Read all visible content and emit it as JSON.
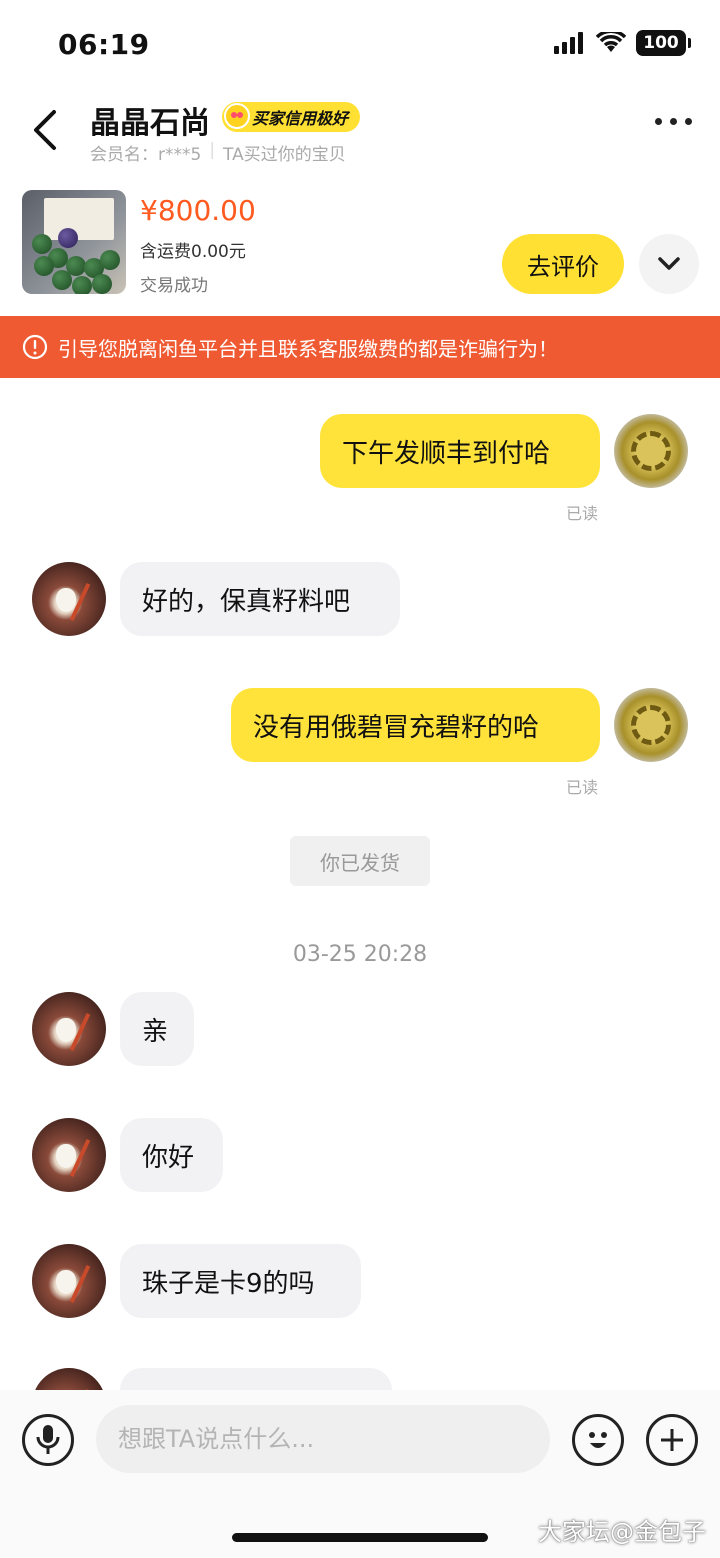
{
  "status_bar": {
    "time": "06:19",
    "battery": "100"
  },
  "header": {
    "title": "晶晶石尚",
    "credit_badge": "买家信用极好",
    "member_name": "会员名：r***5",
    "bought_note": "TA买过你的宝贝"
  },
  "product": {
    "price": "¥800.00",
    "shipping": "含运费0.00元",
    "status": "交易成功",
    "review_label": "去评价"
  },
  "warning": {
    "text": "引导您脱离闲鱼平台并且联系客服缴费的都是诈骗行为！"
  },
  "messages": {
    "m1": {
      "text": "下午发顺丰到付哈",
      "read": "已读"
    },
    "m2": {
      "text": "好的，保真籽料吧"
    },
    "m3": {
      "text": "没有用俄碧冒充碧籽的哈",
      "read": "已读"
    },
    "system": "你已发货",
    "timestamp": "03-25 20:28",
    "m4": {
      "text": "亲"
    },
    "m5": {
      "text": "你好"
    },
    "m6": {
      "text": "珠子是卡9的吗"
    }
  },
  "input": {
    "placeholder": "想跟TA说点什么..."
  },
  "watermark": "大家坛@金包子",
  "colors": {
    "accent_yellow": "#ffe033",
    "warning_orange": "#f05a32",
    "price_orange": "#ff5a1f"
  },
  "icons": [
    "back-arrow-icon",
    "more-icon",
    "chevron-down-icon",
    "alert-icon",
    "microphone-icon",
    "emoji-icon",
    "plus-icon",
    "signal-icon",
    "wifi-icon"
  ]
}
